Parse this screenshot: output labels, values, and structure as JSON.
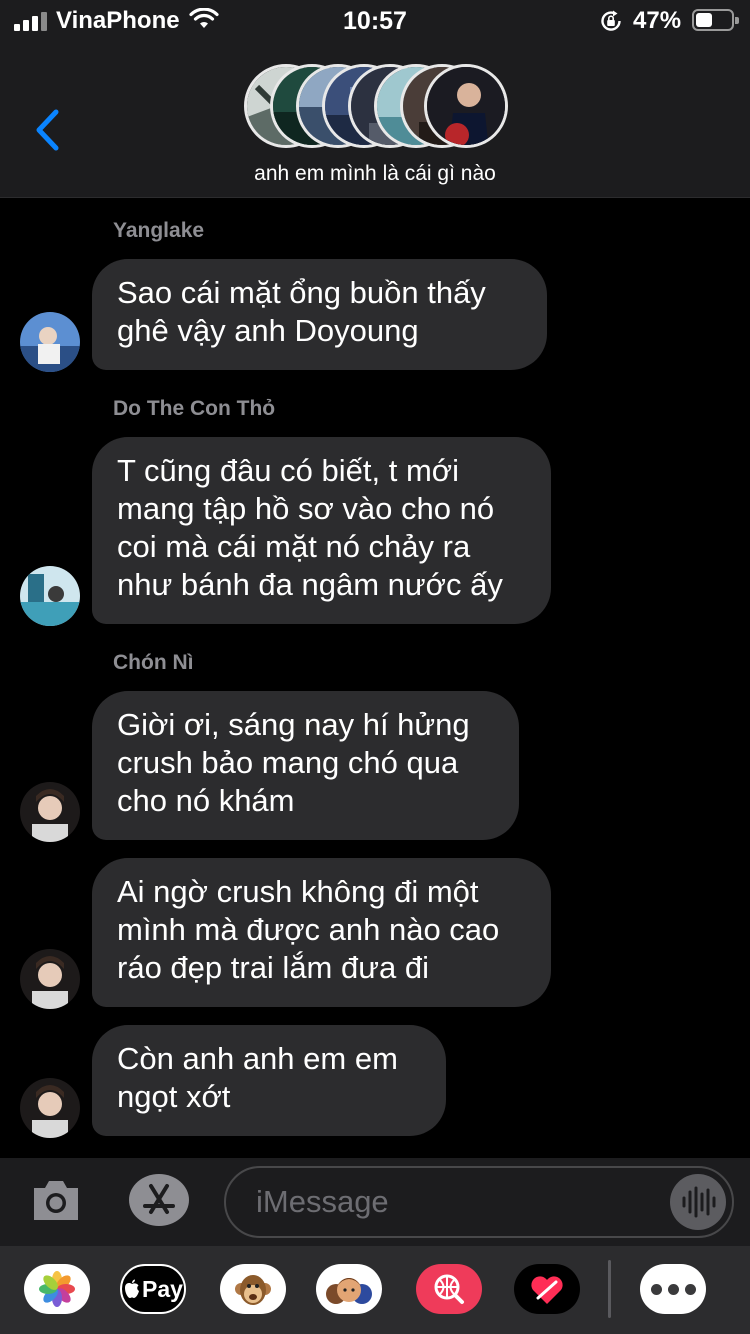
{
  "status_bar": {
    "carrier": "VinaPhone",
    "time": "10:57",
    "battery_percent": "47%",
    "battery_level": 0.47,
    "icons": [
      "signal-icon",
      "wifi-icon",
      "orientation-lock-icon",
      "battery-icon"
    ]
  },
  "header": {
    "back_icon": "chevron-left-icon",
    "group_name": "anh em mình là cái gì nào",
    "accent_color": "#0a84ff"
  },
  "messages": [
    {
      "sender": "Yanglake",
      "text": "Sao cái mặt ổng buồn thấy ghê vậy anh Doyoung"
    },
    {
      "sender": "Do The Con Thỏ",
      "text": "T cũng đâu có biết, t mới mang tập hồ sơ vào cho nó coi mà cái mặt nó chảy ra như bánh đa ngâm nước ấy"
    },
    {
      "sender": "Chón Nì",
      "text": "Giời ơi, sáng nay hí hửng crush bảo mang chó qua cho nó khám"
    },
    {
      "sender": "",
      "text": "Ai ngờ crush không đi một mình mà được anh nào cao ráo đẹp trai lắm đưa đi"
    },
    {
      "sender": "",
      "text": "Còn anh anh em em ngọt xớt"
    }
  ],
  "input_bar": {
    "placeholder": "iMessage",
    "icons": [
      "camera-icon",
      "app-store-icon",
      "audio-waveform-icon"
    ]
  },
  "app_drawer": {
    "apps": [
      "photos-icon",
      "apple-pay-icon",
      "animoji-icon",
      "memoji-icon",
      "web-search-icon",
      "digital-touch-icon",
      "more-icon"
    ],
    "apple_pay_label": "Pay"
  },
  "colors": {
    "background": "#000000",
    "bar_background": "#1c1c1e",
    "bubble_background": "#2c2c2e",
    "sender_name": "#8e8e93"
  }
}
